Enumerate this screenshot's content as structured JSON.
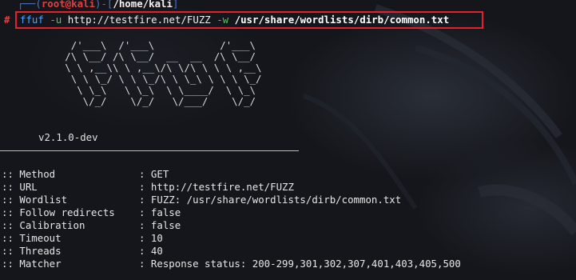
{
  "prompt": {
    "user_host": "root@kali",
    "path": "/home/kali"
  },
  "command": {
    "program": "ffuf",
    "flag_u": "-u",
    "url": "http://testfire.net/FUZZ",
    "flag_w": "-w",
    "wordlist": "/usr/share/wordlists/dirb/common.txt"
  },
  "banner": {
    "ascii_lines": [
      "      /'___\\  /'___\\           /'___\\",
      "     /\\ \\__/ /\\ \\__/  __  __  /\\ \\__/",
      "     \\ \\ ,__\\\\ \\ ,__\\/\\ \\/\\ \\ \\ \\ ,__\\",
      "      \\ \\ \\_/ \\ \\ \\_/\\ \\ \\_\\ \\ \\ \\ \\_/",
      "       \\ \\_\\   \\ \\_\\  \\ \\____/  \\ \\_\\",
      "        \\/_/    \\/_/   \\/___/    \\/_/"
    ],
    "version": "v2.1.0-dev"
  },
  "config": [
    {
      "key": ":: Method",
      "value": ": GET"
    },
    {
      "key": ":: URL",
      "value": ": http://testfire.net/FUZZ"
    },
    {
      "key": ":: Wordlist",
      "value": ": FUZZ: /usr/share/wordlists/dirb/common.txt"
    },
    {
      "key": ":: Follow redirects",
      "value": ": false"
    },
    {
      "key": ":: Calibration",
      "value": ": false"
    },
    {
      "key": ":: Timeout",
      "value": ": 10"
    },
    {
      "key": ":: Threads",
      "value": ": 40"
    },
    {
      "key": ":: Matcher",
      "value": ": Response status: 200-299,301,302,307,401,403,405,500"
    }
  ],
  "colors": {
    "prompt_red": "#e04040",
    "highlight_border": "#e0222a",
    "program_blue": "#4ea3ff",
    "flag_green": "#56c25c"
  }
}
